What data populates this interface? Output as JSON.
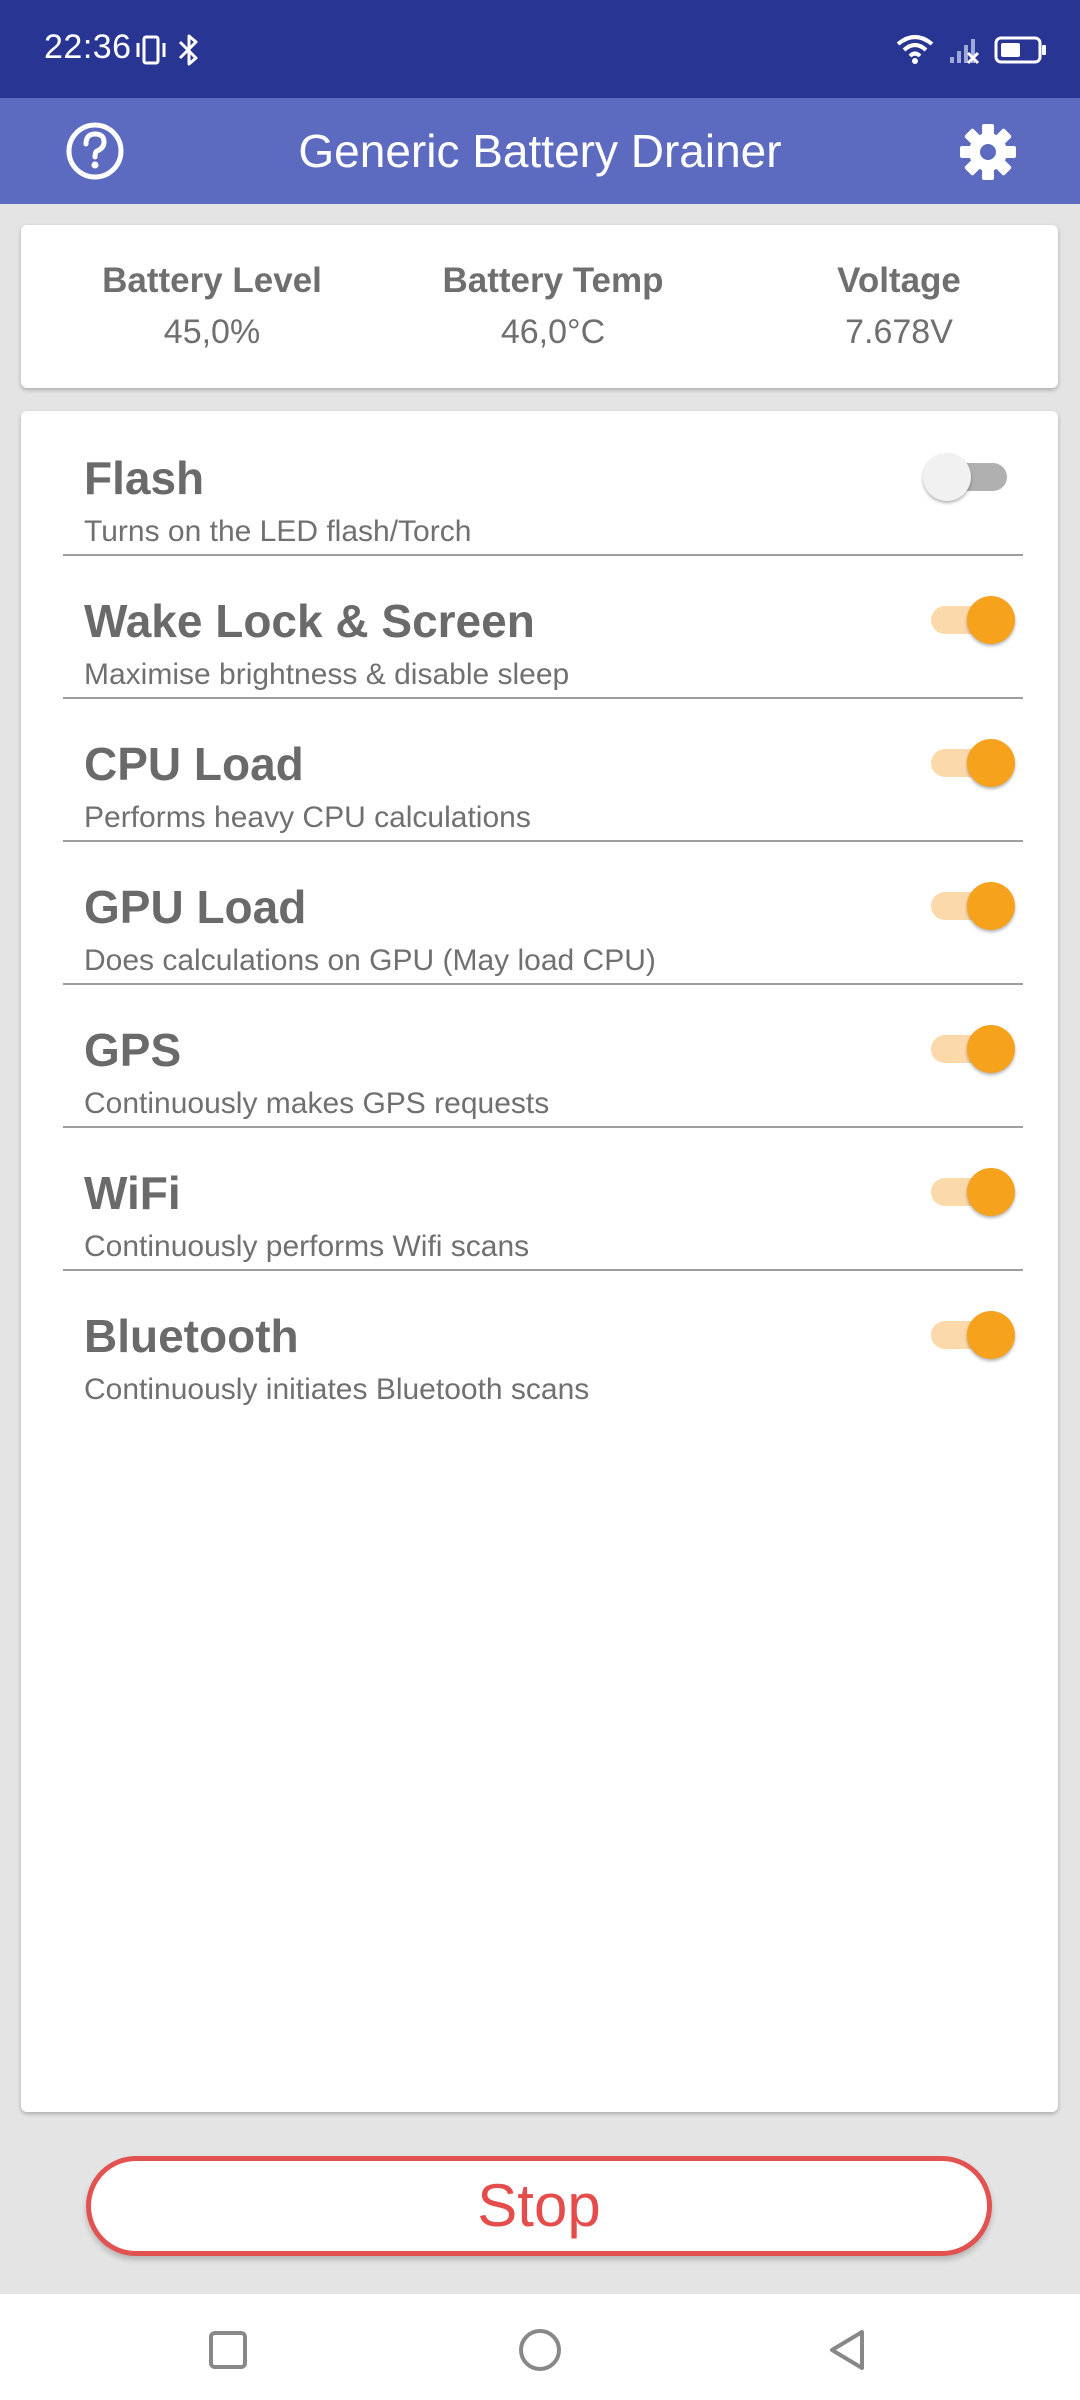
{
  "status_bar": {
    "time": "22:36",
    "icons": [
      "vibrate-icon",
      "bluetooth-icon",
      "wifi-icon",
      "signal-icon",
      "battery-icon"
    ],
    "background": "#283593"
  },
  "app_bar": {
    "title": "Generic Battery Drainer",
    "background": "#5c6bc0",
    "left_icon": "help-icon",
    "right_icon": "settings-icon"
  },
  "stats": {
    "battery_level": {
      "label": "Battery Level",
      "value": "45,0%"
    },
    "battery_temp": {
      "label": "Battery Temp",
      "value": "46,0°C"
    },
    "voltage": {
      "label": "Voltage",
      "value": "7.678V"
    }
  },
  "options": [
    {
      "title": "Flash",
      "description": "Turns on the LED flash/Torch",
      "enabled": false
    },
    {
      "title": "Wake Lock & Screen",
      "description": "Maximise brightness & disable sleep",
      "enabled": true
    },
    {
      "title": "CPU Load",
      "description": "Performs heavy CPU calculations",
      "enabled": true
    },
    {
      "title": "GPU Load",
      "description": "Does calculations on GPU (May load CPU)",
      "enabled": true
    },
    {
      "title": "GPS",
      "description": "Continuously makes GPS requests",
      "enabled": true
    },
    {
      "title": "WiFi",
      "description": "Continuously performs Wifi scans",
      "enabled": true
    },
    {
      "title": "Bluetooth",
      "description": "Continuously initiates Bluetooth scans",
      "enabled": true
    }
  ],
  "stop_button": {
    "label": "Stop",
    "color": "#e44d4b"
  },
  "accent_color": "#f6a21d",
  "nav_bar": {
    "icons": [
      "recents-icon",
      "home-icon",
      "back-icon"
    ]
  }
}
